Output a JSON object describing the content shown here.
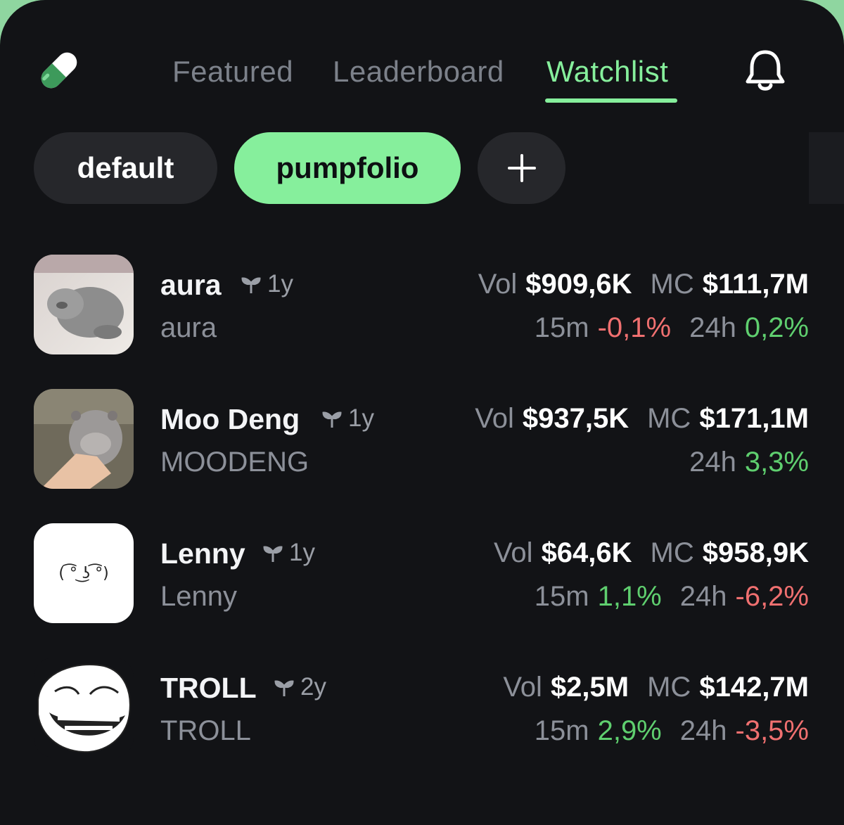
{
  "nav": {
    "tabs": [
      {
        "label": "Featured",
        "active": false
      },
      {
        "label": "Leaderboard",
        "active": false
      },
      {
        "label": "Watchlist",
        "active": true
      }
    ],
    "icons": {
      "logo": "pill-icon",
      "notifications": "bell-icon"
    }
  },
  "chips": {
    "default_label": "default",
    "pumpfolio_label": "pumpfolio",
    "add_icon": "plus-icon",
    "selected": "pumpfolio"
  },
  "colors": {
    "accent": "#86ef9c",
    "background": "#121316",
    "positive": "#5fcf6f",
    "negative": "#f07070"
  },
  "tokens": [
    {
      "name": "aura",
      "age": "1y",
      "ticker": "aura",
      "vol_label": "Vol",
      "vol": "$909,6K",
      "mc_label": "MC",
      "mc": "$111,7M",
      "m15_label": "15m",
      "m15": "-0,1%",
      "h24_label": "24h",
      "h24": "0,2%"
    },
    {
      "name": "Moo Deng",
      "age": "1y",
      "ticker": "MOODENG",
      "vol_label": "Vol",
      "vol": "$937,5K",
      "mc_label": "MC",
      "mc": "$171,1M",
      "h24_label": "24h",
      "h24": "3,3%"
    },
    {
      "name": "Lenny",
      "age": "1y",
      "ticker": "Lenny",
      "thumb_text": "( ͡° ͜ʖ ͡°)",
      "vol_label": "Vol",
      "vol": "$64,6K",
      "mc_label": "MC",
      "mc": "$958,9K",
      "m15_label": "15m",
      "m15": "1,1%",
      "h24_label": "24h",
      "h24": "-6,2%"
    },
    {
      "name": "TROLL",
      "age": "2y",
      "ticker": "TROLL",
      "vol_label": "Vol",
      "vol": "$2,5M",
      "mc_label": "MC",
      "mc": "$142,7M",
      "m15_label": "15m",
      "m15": "2,9%",
      "h24_label": "24h",
      "h24": "-3,5%"
    }
  ]
}
